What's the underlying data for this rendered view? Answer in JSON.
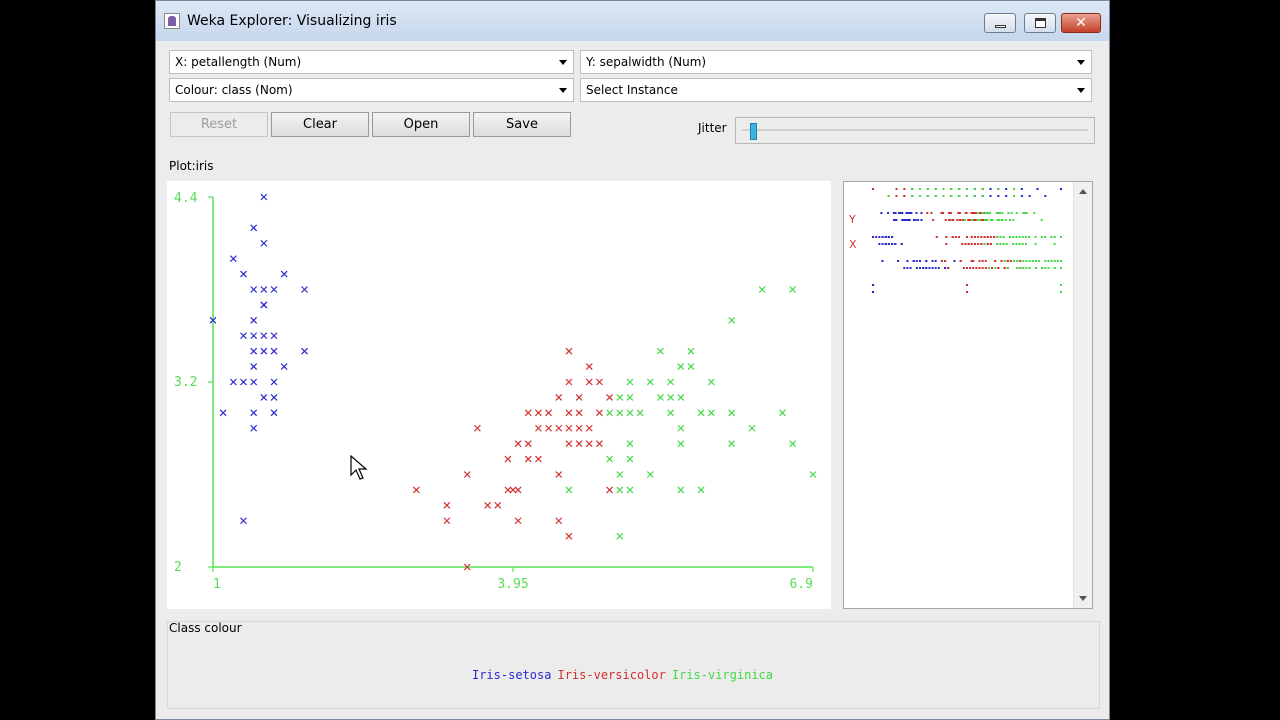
{
  "window": {
    "title": "Weka Explorer: Visualizing iris"
  },
  "controls": {
    "x_axis": "X: petallength (Num)",
    "y_axis": "Y: sepalwidth (Num)",
    "colour": "Colour: class (Nom)",
    "select": "Select Instance",
    "buttons": {
      "reset": "Reset",
      "clear": "Clear",
      "open": "Open",
      "save": "Save"
    },
    "jitter_label": "Jitter",
    "jitter_value": 0.03
  },
  "plot_label": "Plot:iris",
  "side_labels": {
    "y": "Y",
    "x": "X"
  },
  "class_colour_label": "Class colour",
  "colors": {
    "setosa": "#2A2AD0",
    "versicolor": "#D23030",
    "virginica": "#45D845",
    "axis": "#55E055"
  },
  "chart_data": {
    "type": "scatter",
    "xlabel": "",
    "ylabel": "",
    "xlim": [
      1,
      6.9
    ],
    "ylim": [
      2,
      4.4
    ],
    "x_ticks": [
      "1",
      "3.95",
      "6.9"
    ],
    "y_ticks": [
      "2",
      "3.2",
      "4.4"
    ],
    "legend": [
      "Iris-setosa",
      "Iris-versicolor",
      "Iris-virginica"
    ],
    "series": [
      {
        "name": "Iris-setosa",
        "points": [
          [
            1.5,
            4.4
          ],
          [
            1.4,
            4.2
          ],
          [
            1.5,
            4.1
          ],
          [
            1.2,
            4.0
          ],
          [
            1.3,
            3.9
          ],
          [
            1.7,
            3.9
          ],
          [
            1.5,
            3.8
          ],
          [
            1.6,
            3.8
          ],
          [
            1.4,
            3.8
          ],
          [
            1.9,
            3.8
          ],
          [
            1.5,
            3.7
          ],
          [
            1.5,
            3.7
          ],
          [
            1.0,
            3.6
          ],
          [
            1.4,
            3.6
          ],
          [
            1.3,
            3.5
          ],
          [
            1.4,
            3.5
          ],
          [
            1.5,
            3.5
          ],
          [
            1.6,
            3.5
          ],
          [
            1.4,
            3.4
          ],
          [
            1.5,
            3.4
          ],
          [
            1.6,
            3.4
          ],
          [
            1.9,
            3.4
          ],
          [
            1.4,
            3.3
          ],
          [
            1.7,
            3.3
          ],
          [
            1.2,
            3.2
          ],
          [
            1.3,
            3.2
          ],
          [
            1.4,
            3.2
          ],
          [
            1.6,
            3.2
          ],
          [
            1.5,
            3.1
          ],
          [
            1.6,
            3.1
          ],
          [
            1.1,
            3.0
          ],
          [
            1.4,
            3.0
          ],
          [
            1.6,
            3.0
          ],
          [
            1.4,
            2.9
          ],
          [
            1.3,
            2.3
          ]
        ]
      },
      {
        "name": "Iris-versicolor",
        "points": [
          [
            4.5,
            3.4
          ],
          [
            4.7,
            3.3
          ],
          [
            4.5,
            3.2
          ],
          [
            4.7,
            3.2
          ],
          [
            4.8,
            3.2
          ],
          [
            4.4,
            3.1
          ],
          [
            4.6,
            3.1
          ],
          [
            4.9,
            3.1
          ],
          [
            4.2,
            3.0
          ],
          [
            4.3,
            3.0
          ],
          [
            4.5,
            3.0
          ],
          [
            4.6,
            3.0
          ],
          [
            4.8,
            3.0
          ],
          [
            4.1,
            3.0
          ],
          [
            3.6,
            2.9
          ],
          [
            4.2,
            2.9
          ],
          [
            4.3,
            2.9
          ],
          [
            4.4,
            2.9
          ],
          [
            4.5,
            2.9
          ],
          [
            4.6,
            2.9
          ],
          [
            4.7,
            2.9
          ],
          [
            4.0,
            2.8
          ],
          [
            4.1,
            2.8
          ],
          [
            4.5,
            2.8
          ],
          [
            4.6,
            2.8
          ],
          [
            4.7,
            2.8
          ],
          [
            4.8,
            2.8
          ],
          [
            3.9,
            2.7
          ],
          [
            4.1,
            2.7
          ],
          [
            4.2,
            2.7
          ],
          [
            3.5,
            2.6
          ],
          [
            4.4,
            2.6
          ],
          [
            3.95,
            2.5
          ],
          [
            4.0,
            2.5
          ],
          [
            3.0,
            2.5
          ],
          [
            3.9,
            2.5
          ],
          [
            4.9,
            2.5
          ],
          [
            3.3,
            2.4
          ],
          [
            3.7,
            2.4
          ],
          [
            3.8,
            2.4
          ],
          [
            3.3,
            2.3
          ],
          [
            4.0,
            2.3
          ],
          [
            4.4,
            2.3
          ],
          [
            4.5,
            2.2
          ],
          [
            3.5,
            2.0
          ]
        ]
      },
      {
        "name": "Iris-virginica",
        "points": [
          [
            6.4,
            3.8
          ],
          [
            6.7,
            3.8
          ],
          [
            6.1,
            3.6
          ],
          [
            5.7,
            3.4
          ],
          [
            5.4,
            3.4
          ],
          [
            5.6,
            3.3
          ],
          [
            5.7,
            3.3
          ],
          [
            5.1,
            3.2
          ],
          [
            5.3,
            3.2
          ],
          [
            5.5,
            3.2
          ],
          [
            5.9,
            3.2
          ],
          [
            5.0,
            3.1
          ],
          [
            5.1,
            3.1
          ],
          [
            5.4,
            3.1
          ],
          [
            5.5,
            3.1
          ],
          [
            5.6,
            3.1
          ],
          [
            4.9,
            3.0
          ],
          [
            5.0,
            3.0
          ],
          [
            5.1,
            3.0
          ],
          [
            5.2,
            3.0
          ],
          [
            5.5,
            3.0
          ],
          [
            5.8,
            3.0
          ],
          [
            5.9,
            3.0
          ],
          [
            6.1,
            3.0
          ],
          [
            6.6,
            3.0
          ],
          [
            5.6,
            2.9
          ],
          [
            6.3,
            2.9
          ],
          [
            5.1,
            2.8
          ],
          [
            5.6,
            2.8
          ],
          [
            6.1,
            2.8
          ],
          [
            6.7,
            2.8
          ],
          [
            4.9,
            2.7
          ],
          [
            5.1,
            2.7
          ],
          [
            5.0,
            2.6
          ],
          [
            5.3,
            2.6
          ],
          [
            5.6,
            2.5
          ],
          [
            6.9,
            2.6
          ],
          [
            4.5,
            2.5
          ],
          [
            5.0,
            2.5
          ],
          [
            5.1,
            2.5
          ],
          [
            5.8,
            2.5
          ],
          [
            5.0,
            2.2
          ]
        ]
      }
    ]
  }
}
